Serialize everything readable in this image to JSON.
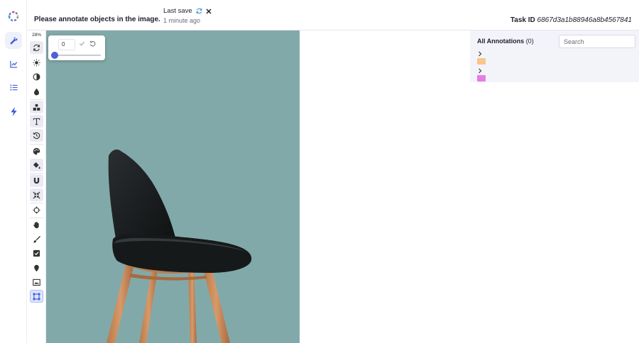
{
  "header": {
    "instructions": "Please annotate objects in the image.",
    "save_label": "Last save",
    "save_time": "1 minute ago",
    "task_label": "Task ID",
    "task_id": "6867d3a1b88946a8b4567841"
  },
  "rail": {
    "items": [
      {
        "name": "wrench-icon",
        "active": true
      },
      {
        "name": "chart-line-icon",
        "active": false
      },
      {
        "name": "list-icon",
        "active": false
      },
      {
        "name": "lightning-icon",
        "active": false
      }
    ]
  },
  "toolbar": {
    "zoom": "28%"
  },
  "popover": {
    "value": "0",
    "slider_level": 0
  },
  "panel": {
    "title": "All Annotations",
    "count": "(0)",
    "search_placeholder": "Search",
    "groups": [
      {
        "color": "#f7c58d"
      },
      {
        "color": "#e87ae8"
      }
    ]
  },
  "colors": {
    "canvas_bg": "#82a9a9",
    "accent": "#4f5fdc",
    "rail_accent": "#3d5bd9"
  }
}
